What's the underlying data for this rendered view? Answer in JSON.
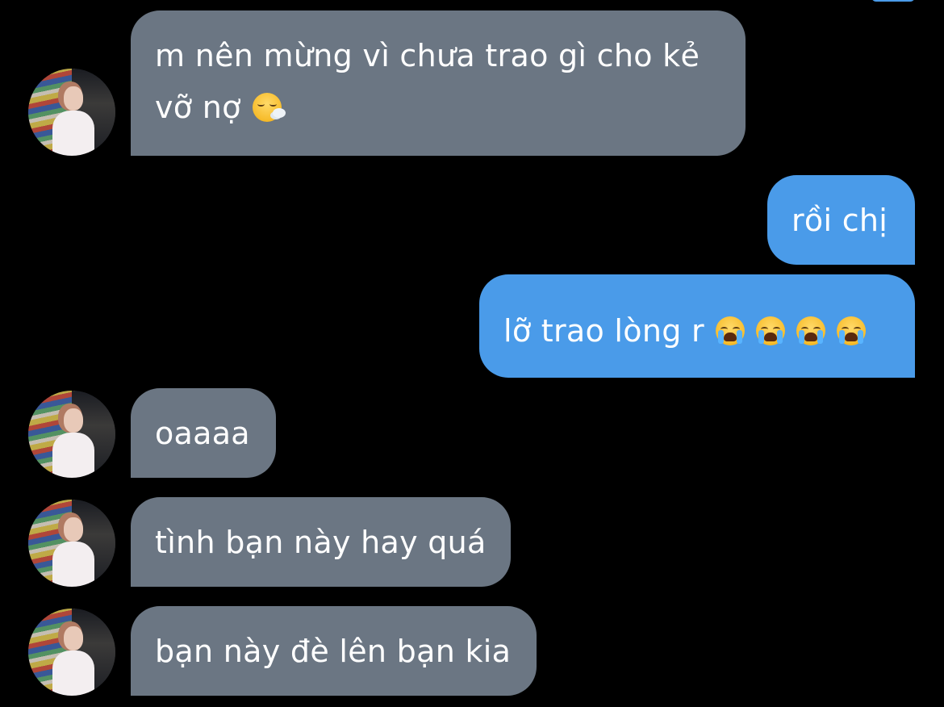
{
  "chat": {
    "messages": [
      {
        "direction": "incoming",
        "lines": [
          "m nên mừng vì chưa trao gì cho kẻ",
          "vỡ nợ"
        ],
        "emoji": "face-exhaling-emoji",
        "has_avatar": true
      },
      {
        "direction": "outgoing",
        "text": "rồi chị"
      },
      {
        "direction": "outgoing",
        "text": "lỡ trao lòng r",
        "emoji": "loudly-crying-face-emoji",
        "emoji_count": 4
      },
      {
        "direction": "incoming",
        "text": "oaaaa",
        "has_avatar": true
      },
      {
        "direction": "incoming",
        "text": "tình bạn này hay quá",
        "has_avatar": true
      },
      {
        "direction": "incoming",
        "text": "bạn này đè lên bạn kia",
        "has_avatar": true
      }
    ]
  },
  "colors": {
    "background": "#000000",
    "incoming_bubble": "#6b7683",
    "outgoing_bubble": "#4a9be9",
    "text": "#ffffff"
  }
}
